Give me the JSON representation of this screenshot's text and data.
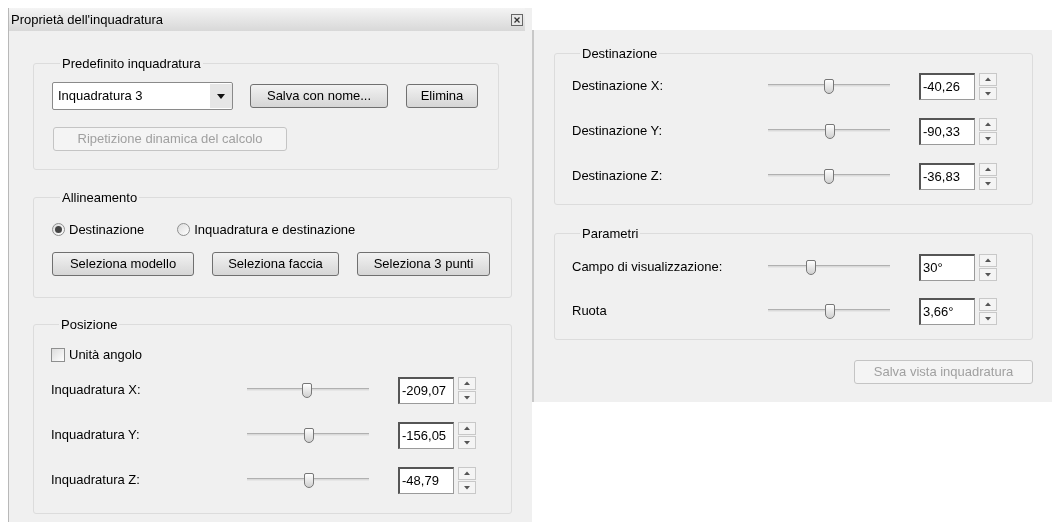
{
  "window": {
    "title": "Proprietà dell'inquadratura"
  },
  "preset": {
    "legend": "Predefinito inquadratura",
    "dropdown": {
      "value": "Inquadratura 3"
    },
    "buttons": [
      {
        "label": "Salva con nome...",
        "disabled": false
      },
      {
        "label": "Elimina",
        "disabled": false
      }
    ],
    "recalc_button": {
      "label": "Ripetizione dinamica del calcolo",
      "disabled": true
    }
  },
  "alignment": {
    "legend": "Allineamento",
    "options": [
      {
        "label": "Destinazione",
        "selected": true
      },
      {
        "label": "Inquadratura e destinazione",
        "selected": false
      }
    ],
    "buttons": [
      {
        "label": "Seleziona modello",
        "disabled": false
      },
      {
        "label": "Seleziona faccia",
        "disabled": false
      },
      {
        "label": "Seleziona 3 punti",
        "disabled": false
      }
    ]
  },
  "position": {
    "legend": "Posizione",
    "angle_units": {
      "label": "Unità angolo",
      "checked": false
    },
    "rows": [
      {
        "label": "Inquadratura X:",
        "level": 0.49,
        "value": "-209,07"
      },
      {
        "label": "Inquadratura Y:",
        "level": 0.51,
        "value": "-156,05"
      },
      {
        "label": "Inquadratura Z:",
        "level": 0.51,
        "value": "-48,79"
      }
    ]
  },
  "target": {
    "legend": "Destinazione",
    "rows": [
      {
        "label": "Destinazione X:",
        "level": 0.5,
        "value": "-40,26"
      },
      {
        "label": "Destinazione Y:",
        "level": 0.51,
        "value": "-90,33"
      },
      {
        "label": "Destinazione Z:",
        "level": 0.5,
        "value": "-36,83"
      }
    ]
  },
  "parameters": {
    "legend": "Parametri",
    "rows": [
      {
        "label": "Campo di visualizzazione:",
        "level": 0.35,
        "value": "30°"
      },
      {
        "label": "Ruota",
        "level": 0.51,
        "value": "3,66°"
      }
    ]
  },
  "save_view_button": {
    "label": "Salva vista inquadratura",
    "disabled": true
  }
}
